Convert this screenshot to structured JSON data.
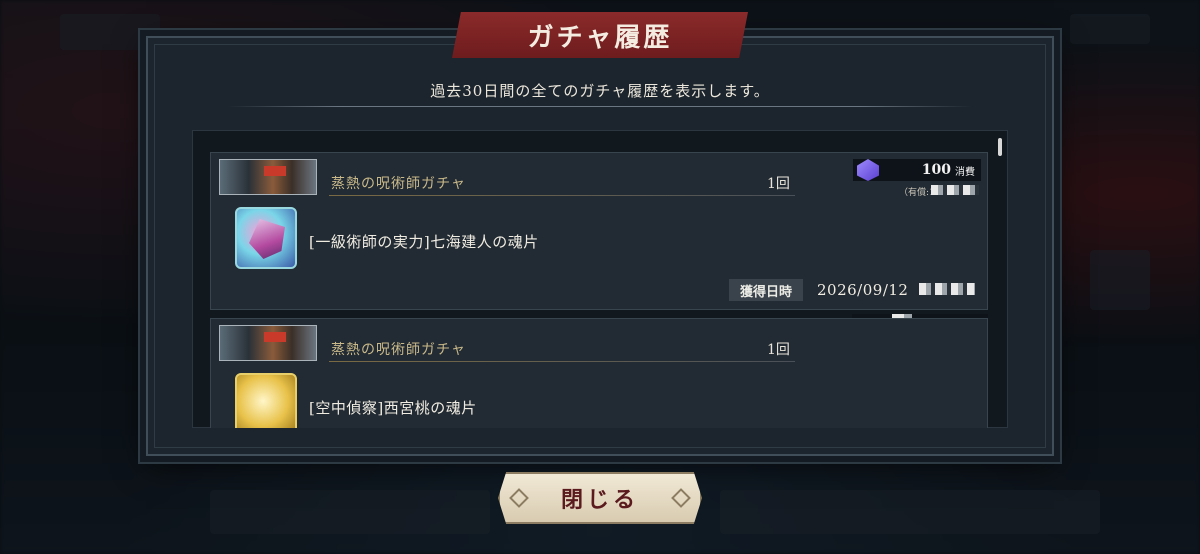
{
  "dialog": {
    "title": "ガチャ履歴",
    "subtitle": "過去30日間の全てのガチャ履歴を表示します。",
    "close_label": "閉じる"
  },
  "entries": [
    {
      "gacha_name": "蒸熱の呪術師ガチャ",
      "count": "1回",
      "cost_value": "100",
      "cost_unit": "消費",
      "paid_note": "（有償:1",
      "item_name": "[一級術師の実力]七海建人の魂片",
      "date_label": "獲得日時",
      "date_value": "2026/09/12"
    },
    {
      "gacha_name": "蒸熱の呪術師ガチャ",
      "count": "1回",
      "item_name": "[空中偵察]西宮桃の魂片"
    }
  ],
  "colors": {
    "title_banner": "#7a2224",
    "gacha_name": "#c9b98a",
    "panel": "#222b33",
    "close_text": "#5a1a1e"
  },
  "icons": [
    "gem-icon",
    "soul-fragment-icon"
  ]
}
